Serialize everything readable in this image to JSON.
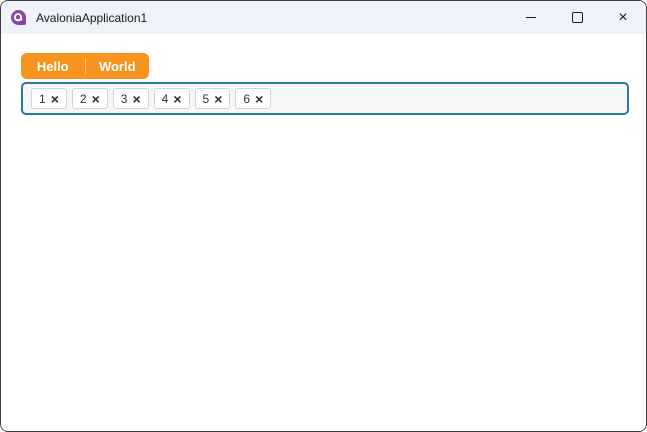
{
  "window": {
    "title": "AvaloniaApplication1"
  },
  "icons": {
    "logo": "avalonia-logo",
    "minimize": "─",
    "maximize": "□",
    "close": "×",
    "chip_close": "×"
  },
  "tab_strip": {
    "tabs": [
      {
        "label": "Hello"
      },
      {
        "label": "World"
      }
    ]
  },
  "chip_input": {
    "chips": [
      {
        "label": "1"
      },
      {
        "label": "2"
      },
      {
        "label": "3"
      },
      {
        "label": "4"
      },
      {
        "label": "5"
      },
      {
        "label": "6"
      }
    ]
  },
  "colors": {
    "accent_orange": "#F7941D",
    "chip_box_border": "#2878AD",
    "chip_box_bg": "#F5F6F8",
    "titlebar_bg": "#EEF3F9",
    "logo_purple": "#8B44AC",
    "window_border": "#3E3E3E"
  }
}
